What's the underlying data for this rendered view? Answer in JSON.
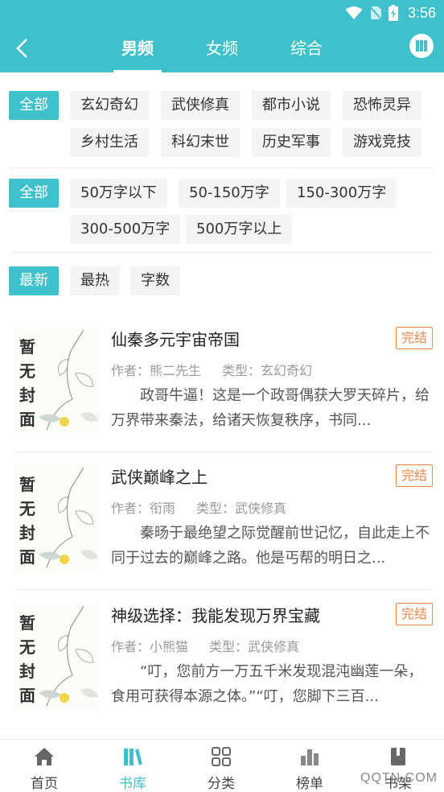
{
  "status_bar": {
    "time": "3:56"
  },
  "nav": {
    "tabs": [
      {
        "label": "男频",
        "active": true
      },
      {
        "label": "女频",
        "active": false
      },
      {
        "label": "综合",
        "active": false
      }
    ]
  },
  "filters": {
    "category": {
      "all_label": "全部",
      "options": [
        "玄幻奇幻",
        "武侠修真",
        "都市小说",
        "恐怖灵异",
        "乡村生活",
        "科幻末世",
        "历史军事",
        "游戏竞技"
      ]
    },
    "word_count": {
      "all_label": "全部",
      "options": [
        "50万字以下",
        "50-150万字",
        "150-300万字",
        "300-500万字",
        "500万字以上"
      ]
    },
    "sort": {
      "options": [
        "最新",
        "最热",
        "字数"
      ],
      "selected": "最新"
    }
  },
  "cover_placeholder": "暂无封面",
  "books": [
    {
      "title": "仙秦多元宇宙帝国",
      "status": "完结",
      "author": "作者：熊二先生",
      "type": "类型：玄幻奇幻",
      "description": "政哥牛逼！这是一个政哥偶获大罗天碎片，给万界带来秦法，给诸天恢复秩序，书同..."
    },
    {
      "title": "武侠巅峰之上",
      "status": "完结",
      "author": "作者：衔雨",
      "type": "类型：武侠修真",
      "description": "秦旸于最绝望之际觉醒前世记忆，自此走上不同于过去的巅峰之路。他是丐帮的明日之..."
    },
    {
      "title": "神级选择：我能发现万界宝藏",
      "status": "完结",
      "author": "作者：小熊猫",
      "type": "类型：武侠修真",
      "description": "“叮，您前方一万五千米发现混沌幽莲一朵，食用可获得本源之体。”“叮，您脚下三百..."
    }
  ],
  "bottom_nav": {
    "items": [
      {
        "label": "首页",
        "icon": "home-icon",
        "active": false
      },
      {
        "label": "书库",
        "icon": "library-icon",
        "active": true
      },
      {
        "label": "分类",
        "icon": "grid-icon",
        "active": false
      },
      {
        "label": "榜单",
        "icon": "ranking-icon",
        "active": false
      },
      {
        "label": "书架",
        "icon": "bookshelf-icon",
        "active": false
      }
    ]
  },
  "watermark": "QQTN.COM",
  "colors": {
    "accent": "#3fc1cc",
    "badge": "#e8864b",
    "chip_bg": "#f4f4f4"
  }
}
